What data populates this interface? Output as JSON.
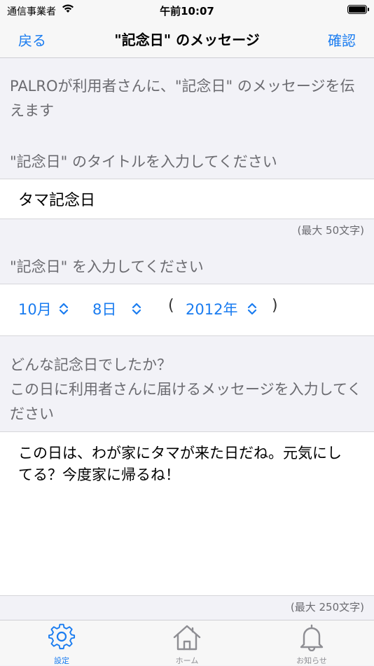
{
  "status_bar": {
    "carrier": "通信事業者",
    "time": "午前10:07"
  },
  "nav": {
    "back_label": "戻る",
    "title": "\"記念日\" のメッセージ",
    "confirm_label": "確認"
  },
  "intro_text": "PALROが利用者さんに、\"記念日\" のメッセージを伝えます",
  "title_section": {
    "header": "\"記念日\" のタイトルを入力してください",
    "value": "タマ記念日",
    "limit": "(最大 50文字)"
  },
  "date_section": {
    "header": "\"記念日\" を入力してください",
    "month": "10月",
    "day": "8日",
    "open_paren": "(",
    "year": "2012年",
    "close_paren": ")"
  },
  "message_section": {
    "header_line1": "どんな記念日でしたか？",
    "header_line2": "この日に利用者さんに届けるメッセージを入力してください",
    "value": "この日は、わが家にタマが来た日だね。元気にしてる？今度家に帰るね！",
    "limit": "(最大 250文字)"
  },
  "tabs": [
    {
      "label": "設定",
      "icon": "gear-icon",
      "active": true
    },
    {
      "label": "ホーム",
      "icon": "home-icon",
      "active": false
    },
    {
      "label": "お知らせ",
      "icon": "bell-icon",
      "active": false
    }
  ],
  "colors": {
    "accent": "#1a7cf0",
    "background": "#f2f2f7",
    "secondary_text": "#6b6b70"
  }
}
